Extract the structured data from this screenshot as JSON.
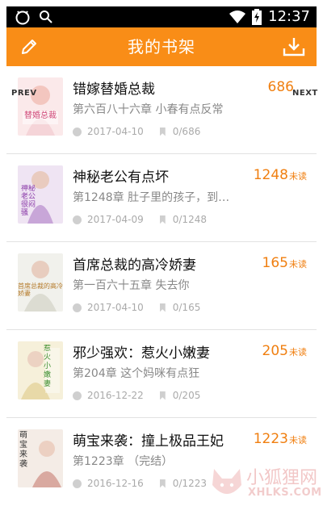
{
  "status_bar": {
    "time": "12:37",
    "left_icons": [
      "android-head-icon",
      "search-icon"
    ],
    "right_icons": [
      "wifi-icon",
      "battery-charging-icon"
    ]
  },
  "app_bar": {
    "title": "我的书架",
    "left_icon": "edit-pencil-icon",
    "right_icon": "download-icon",
    "color": "#F98D17"
  },
  "carousel": {
    "prev_label": "PREV",
    "next_label": "NEXT"
  },
  "unread_suffix": "未读",
  "books": [
    {
      "title": "错嫁替婚总裁",
      "chapter": "第六百八十六章 小春有点反常",
      "date": "2017-04-10",
      "progress": "0/686",
      "unread": "686",
      "cover_text": "替婚总裁",
      "cover_sub": ""
    },
    {
      "title": "神秘老公有点坏",
      "chapter": "第1248章 肚子里的孩子，到…",
      "date": "2017-04-09",
      "progress": "0/1248",
      "unread": "1248",
      "cover_text": "神秘老公很闷骚",
      "cover_sub": ""
    },
    {
      "title": "首席总裁的高冷娇妻",
      "chapter": "第一百六十五章 失去你",
      "date": "2017-04-10",
      "progress": "0/165",
      "unread": "165",
      "cover_text": "首席总裁的高冷娇妻",
      "cover_sub": ""
    },
    {
      "title": "邪少强欢：惹火小嫩妻",
      "chapter": "第204章 这个妈咪有点狂",
      "date": "2016-12-22",
      "progress": "0/205",
      "unread": "205",
      "cover_text": "惹火小嫩妻",
      "cover_sub": ""
    },
    {
      "title": "萌宝来袭：撞上极品王妃",
      "chapter": "第1223章 （完结）",
      "date": "2016-12-16",
      "progress": "0/1223",
      "unread": "1223",
      "cover_text": "萌宝来袭",
      "cover_sub": ""
    }
  ],
  "watermark": {
    "text": "小狐狸网",
    "url_text": "XHLKS.COM"
  }
}
